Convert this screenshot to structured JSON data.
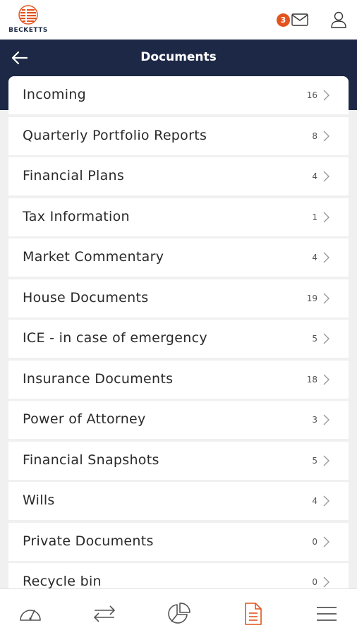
{
  "app": {
    "brand": "BECKETTS",
    "accent_color": "#e2541e",
    "header_color": "#1c2845"
  },
  "topbar": {
    "logo_icon": "becketts-logo",
    "mail_badge": "3",
    "mail_icon": "envelope-icon",
    "profile_icon": "user-icon"
  },
  "header": {
    "back_icon": "arrow-left-icon",
    "title": "Documents"
  },
  "folders": [
    {
      "label": "Incoming",
      "count": "16"
    },
    {
      "label": "Quarterly Portfolio Reports",
      "count": "8"
    },
    {
      "label": "Financial Plans",
      "count": "4"
    },
    {
      "label": "Tax Information",
      "count": "1"
    },
    {
      "label": "Market Commentary",
      "count": "4"
    },
    {
      "label": "House Documents",
      "count": "19"
    },
    {
      "label": "ICE - in case of emergency",
      "count": "5"
    },
    {
      "label": "Insurance Documents",
      "count": "18"
    },
    {
      "label": "Power of Attorney",
      "count": "3"
    },
    {
      "label": "Financial Snapshots",
      "count": "5"
    },
    {
      "label": "Wills",
      "count": "4"
    },
    {
      "label": "Private Documents",
      "count": "0"
    },
    {
      "label": "Recycle bin",
      "count": "0"
    }
  ],
  "bottom_nav": [
    {
      "icon": "dashboard-gauge-icon",
      "active": false
    },
    {
      "icon": "transfer-arrows-icon",
      "active": false
    },
    {
      "icon": "pie-chart-icon",
      "active": false
    },
    {
      "icon": "document-icon",
      "active": true
    },
    {
      "icon": "hamburger-menu-icon",
      "active": false
    }
  ]
}
